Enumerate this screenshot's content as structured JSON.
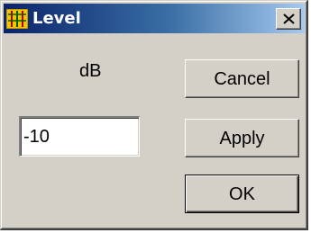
{
  "window": {
    "title": "Level",
    "app_icon": "level-meter-icon",
    "close_icon": "close-icon",
    "colors": {
      "title_gradient_start": "#0a246a",
      "title_gradient_end": "#a6caf0",
      "face": "#d4d0c8"
    }
  },
  "form": {
    "unit_label": "dB",
    "value": "-10"
  },
  "buttons": {
    "cancel": "Cancel",
    "apply": "Apply",
    "ok": "OK"
  }
}
